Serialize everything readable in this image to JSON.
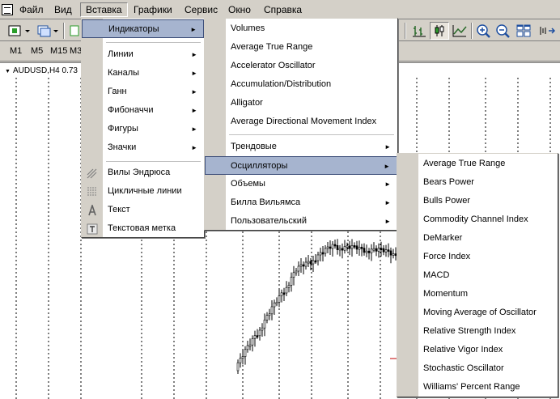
{
  "menubar": {
    "items": [
      "Файл",
      "Вид",
      "Вставка",
      "Графики",
      "Сервис",
      "Окно",
      "Справка"
    ],
    "active_index": 2
  },
  "periods": [
    "M1",
    "M5",
    "M15",
    "M3"
  ],
  "chart": {
    "title": "AUDUSD,H4  0.73"
  },
  "insert_menu": {
    "items": [
      {
        "label": "Индикаторы",
        "submenu": true,
        "highlighted": true
      },
      {
        "label": "Линии",
        "submenu": true
      },
      {
        "label": "Каналы",
        "submenu": true
      },
      {
        "label": "Ганн",
        "submenu": true
      },
      {
        "label": "Фибоначчи",
        "submenu": true
      },
      {
        "label": "Фигуры",
        "submenu": true
      },
      {
        "label": "Значки",
        "submenu": true
      },
      {
        "label": "Вилы Эндрюса",
        "icon": "andrews-pitchfork-icon"
      },
      {
        "label": "Цикличные линии",
        "icon": "cycle-lines-icon"
      },
      {
        "label": "Текст",
        "icon": "text-icon"
      },
      {
        "label": "Текстовая метка",
        "icon": "text-label-icon"
      }
    ]
  },
  "indicators_menu": {
    "items": [
      {
        "label": "Volumes"
      },
      {
        "label": "Average True Range"
      },
      {
        "label": "Accelerator Oscillator"
      },
      {
        "label": "Accumulation/Distribution"
      },
      {
        "label": "Alligator"
      },
      {
        "label": "Average Directional Movement Index"
      },
      {
        "label": "Трендовые",
        "submenu": true
      },
      {
        "label": "Осцилляторы",
        "submenu": true,
        "highlighted": true
      },
      {
        "label": "Объемы",
        "submenu": true
      },
      {
        "label": "Билла Вильямса",
        "submenu": true
      },
      {
        "label": "Пользовательский",
        "submenu": true
      }
    ]
  },
  "oscillators_menu": {
    "items": [
      "Average True Range",
      "Bears Power",
      "Bulls Power",
      "Commodity Channel Index",
      "DeMarker",
      "Force Index",
      "MACD",
      "Momentum",
      "Moving Average of Oscillator",
      "Relative Strength Index",
      "Relative Vigor Index",
      "Stochastic Oscillator",
      "Williams' Percent Range"
    ]
  },
  "colors": {
    "menu_highlight": "#a6b4cf",
    "menu_highlight_border": "#3d4e79",
    "face": "#d4d0c8",
    "chart_bg": "#ffffff"
  }
}
